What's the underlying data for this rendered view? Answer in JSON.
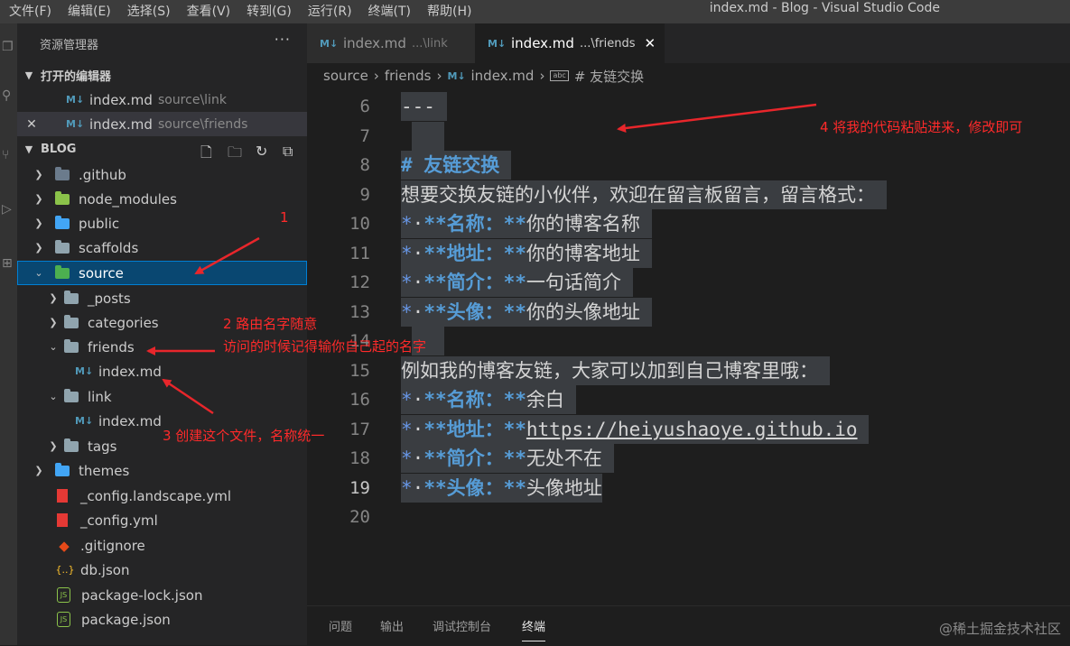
{
  "menubar": {
    "items": [
      "文件(F)",
      "编辑(E)",
      "选择(S)",
      "查看(V)",
      "转到(G)",
      "运行(R)",
      "终端(T)",
      "帮助(H)"
    ],
    "window_title": "index.md - Blog - Visual Studio Code"
  },
  "sidebar": {
    "title": "资源管理器",
    "more": "···",
    "open_editors": {
      "header": "打开的编辑器",
      "items": [
        {
          "icon": "M↓",
          "name": "index.md",
          "desc": "source\\link"
        },
        {
          "icon": "M↓",
          "name": "index.md",
          "desc": "source\\friends"
        }
      ],
      "close": "✕"
    },
    "explorer": {
      "header": "BLOG",
      "items": [
        {
          "name": ".github",
          "icon": "github-folder-icon"
        },
        {
          "name": "node_modules",
          "icon": "node-folder-icon"
        },
        {
          "name": "public",
          "icon": "public-folder-icon"
        },
        {
          "name": "scaffolds",
          "icon": "folder-icon"
        },
        {
          "name": "source",
          "icon": "source-folder-icon"
        },
        {
          "name": "_posts",
          "icon": "folder-icon"
        },
        {
          "name": "categories",
          "icon": "folder-icon"
        },
        {
          "name": "friends",
          "icon": "folder-open-icon"
        },
        {
          "name": "index.md",
          "icon": "M↓"
        },
        {
          "name": "link",
          "icon": "folder-open-icon"
        },
        {
          "name": "index.md",
          "icon": "M↓"
        },
        {
          "name": "tags",
          "icon": "folder-icon"
        },
        {
          "name": "themes",
          "icon": "themes-folder-icon"
        },
        {
          "name": "_config.landscape.yml",
          "icon": "yml-icon"
        },
        {
          "name": "_config.yml",
          "icon": "yml-icon"
        },
        {
          "name": ".gitignore",
          "icon": "git-icon"
        },
        {
          "name": "db.json",
          "icon": "{..}"
        },
        {
          "name": "package-lock.json",
          "icon": "JS"
        },
        {
          "name": "package.json",
          "icon": "JS"
        }
      ]
    }
  },
  "tabs": [
    {
      "icon": "M↓",
      "name": "index.md",
      "desc": "...\\link"
    },
    {
      "icon": "M↓",
      "name": "index.md",
      "desc": "...\\friends",
      "close": "✕"
    }
  ],
  "breadcrumb": {
    "parts": [
      "source",
      "friends",
      "index.md",
      "# 友链交换"
    ],
    "md_icon": "M↓",
    "symbol_icon": "abc"
  },
  "editor": {
    "line_numbers": [
      "6",
      "7",
      "8",
      "9",
      "10",
      "11",
      "12",
      "13",
      "14",
      "15",
      "16",
      "17",
      "18",
      "19",
      "20"
    ],
    "current_line": "19",
    "lines": {
      "l6": "---",
      "l8_hash": "#",
      "l8_text": " 友链交换",
      "l9": "想要交换友链的小伙伴，欢迎在留言板留言，留言格式：",
      "l10_label": "**名称：**",
      "l10_value": "你的博客名称",
      "l11_label": "**地址：**",
      "l11_value": "你的博客地址",
      "l12_label": "**简介：**",
      "l12_value": "一句话简介",
      "l13_label": "**头像：**",
      "l13_value": "你的头像地址",
      "l15": "例如我的博客友链，大家可以加到自己博客里哦：",
      "l16_label": "**名称：**",
      "l16_value": "余白",
      "l17_label": "**地址：**",
      "l17_value": "https://heiyushaoye.github.io",
      "l18_label": "**简介：**",
      "l18_value": "无处不在",
      "l19_label": "**头像：**",
      "l19_value": "头像地址",
      "bullet": "*"
    }
  },
  "panel": {
    "tabs": [
      "问题",
      "输出",
      "调试控制台",
      "终端"
    ],
    "active": "终端"
  },
  "annotations": {
    "a1": "1",
    "a2_line1": "2 路由名字随意",
    "a2_line2": "访问的时候记得输你自己起的名字",
    "a3": "3 创建这个文件，名称统一",
    "a4": "4 将我的代码粘贴进来，修改即可"
  },
  "watermark": "@稀土掘金技术社区",
  "colors": {
    "annotation": "#ff2a2a",
    "selection": "#094771",
    "heading": "#569cd6"
  }
}
